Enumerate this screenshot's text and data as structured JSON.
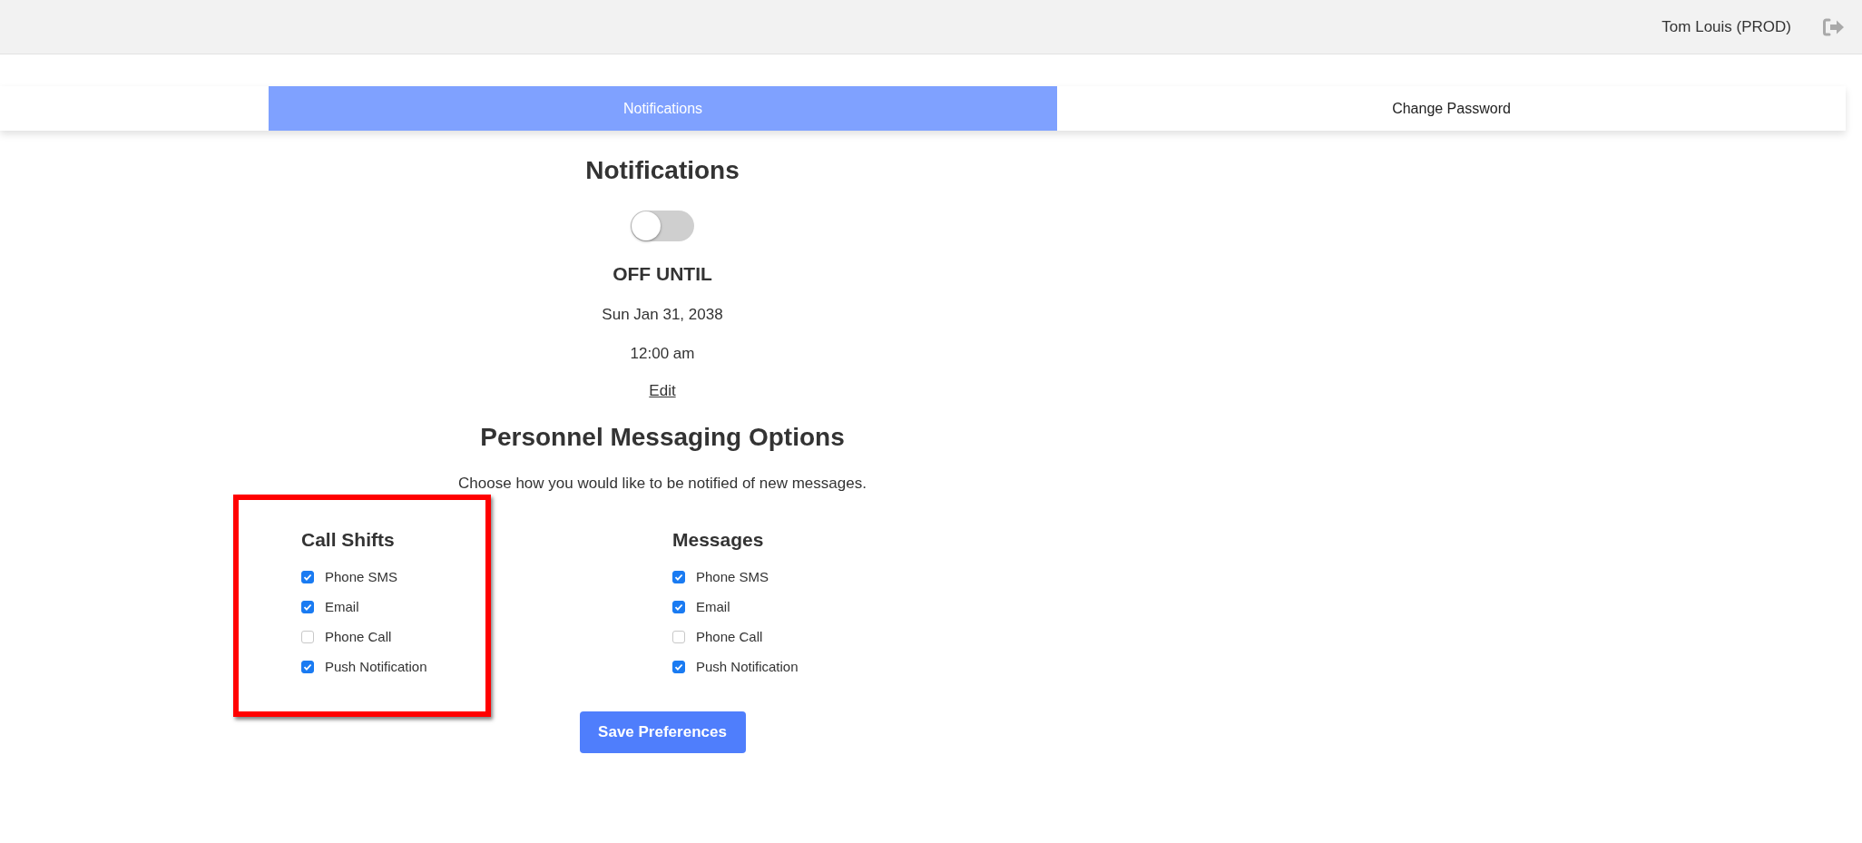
{
  "header": {
    "user": "Tom Louis (PROD)"
  },
  "tabs": [
    {
      "label": "Notifications",
      "selected": true
    },
    {
      "label": "Change Password",
      "selected": false
    }
  ],
  "notifications": {
    "title": "Notifications",
    "enabled": false,
    "status": "OFF UNTIL",
    "date": "Sun Jan 31, 2038",
    "time": "12:00 am",
    "edit_link": "Edit"
  },
  "messaging": {
    "title": "Personnel Messaging Options",
    "description": "Choose how you would like to be notified of new messages.",
    "groups": [
      {
        "title": "Call Shifts",
        "highlighted": true,
        "options": [
          {
            "label": "Phone SMS",
            "checked": true
          },
          {
            "label": "Email",
            "checked": true
          },
          {
            "label": "Phone Call",
            "checked": false
          },
          {
            "label": "Push Notification",
            "checked": true
          }
        ]
      },
      {
        "title": "Messages",
        "highlighted": false,
        "options": [
          {
            "label": "Phone SMS",
            "checked": true
          },
          {
            "label": "Email",
            "checked": true
          },
          {
            "label": "Phone Call",
            "checked": false
          },
          {
            "label": "Push Notification",
            "checked": true
          }
        ]
      }
    ]
  },
  "save_button": "Save Preferences"
}
